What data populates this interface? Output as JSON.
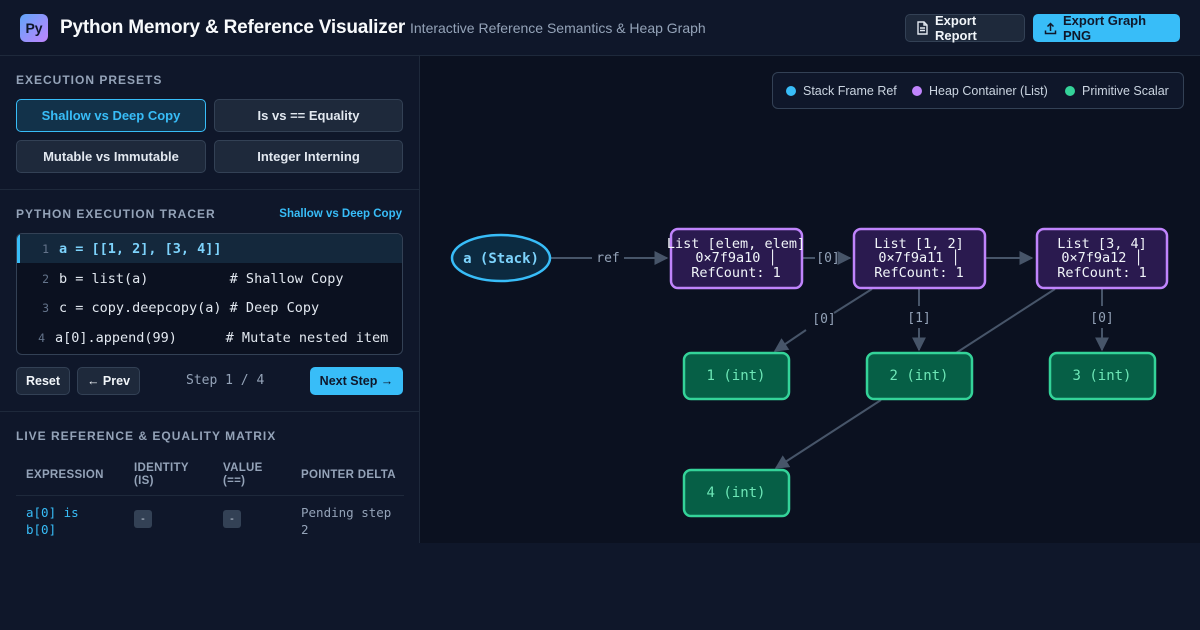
{
  "header": {
    "logo": "Py",
    "title": "Python Memory & Reference Visualizer",
    "subtitle": "Interactive Reference Semantics & Heap Graph",
    "export_report": "Export Report",
    "export_png": "Export Graph PNG"
  },
  "presets": {
    "label": "EXECUTION PRESETS",
    "items": [
      "Shallow vs Deep Copy",
      "Is vs == Equality",
      "Mutable vs Immutable",
      "Integer Interning"
    ],
    "active": "Shallow vs Deep Copy"
  },
  "tracer": {
    "label": "PYTHON EXECUTION TRACER",
    "preset_tag": "Shallow vs Deep Copy",
    "lines": [
      {
        "num": "1",
        "code": "a = [[1, 2], [3, 4]]"
      },
      {
        "num": "2",
        "code": "b = list(a)          # Shallow Copy"
      },
      {
        "num": "3",
        "code": "c = copy.deepcopy(a) # Deep Copy"
      },
      {
        "num": "4",
        "code": "a[0].append(99)      # Mutate nested item"
      }
    ],
    "active_line": 1,
    "reset": "Reset",
    "prev": "← Prev",
    "next": "Next Step →",
    "step_text": "Step 1 / 4"
  },
  "matrix": {
    "label": "LIVE REFERENCE & EQUALITY MATRIX",
    "columns": [
      "EXPRESSION",
      "IDENTITY (IS)",
      "VALUE (==)",
      "POINTER DELTA"
    ],
    "rows": [
      {
        "expression": "a[0] is b[0]",
        "identity": "-",
        "value": "-",
        "delta": "Pending step 2"
      }
    ]
  },
  "legend": {
    "stack": "Stack Frame Ref",
    "heap": "Heap Container (List)",
    "primitive": "Primitive Scalar",
    "colors": {
      "stack": "#38bdf8",
      "heap": "#c084fc",
      "primitive": "#34d399"
    }
  },
  "graph": {
    "stack_node": "a (Stack)",
    "ref_label": "ref",
    "lists": [
      {
        "line1": "List [elem, elem]",
        "line2": "0×7f9a10 │",
        "line3": "RefCount: 1"
      },
      {
        "line1": "List [1, 2]",
        "line2": "0×7f9a11 │",
        "line3": "RefCount: 1"
      },
      {
        "line1": "List [3, 4]",
        "line2": "0×7f9a12 │",
        "line3": "RefCount: 1"
      }
    ],
    "ints": [
      "1 (int)",
      "2 (int)",
      "3 (int)",
      "4 (int)"
    ],
    "edge_labels": {
      "outer_to_first": "[0]",
      "first_to_1": "[0]",
      "first_to_2": "[1]",
      "second_to_3": "[0]"
    }
  }
}
